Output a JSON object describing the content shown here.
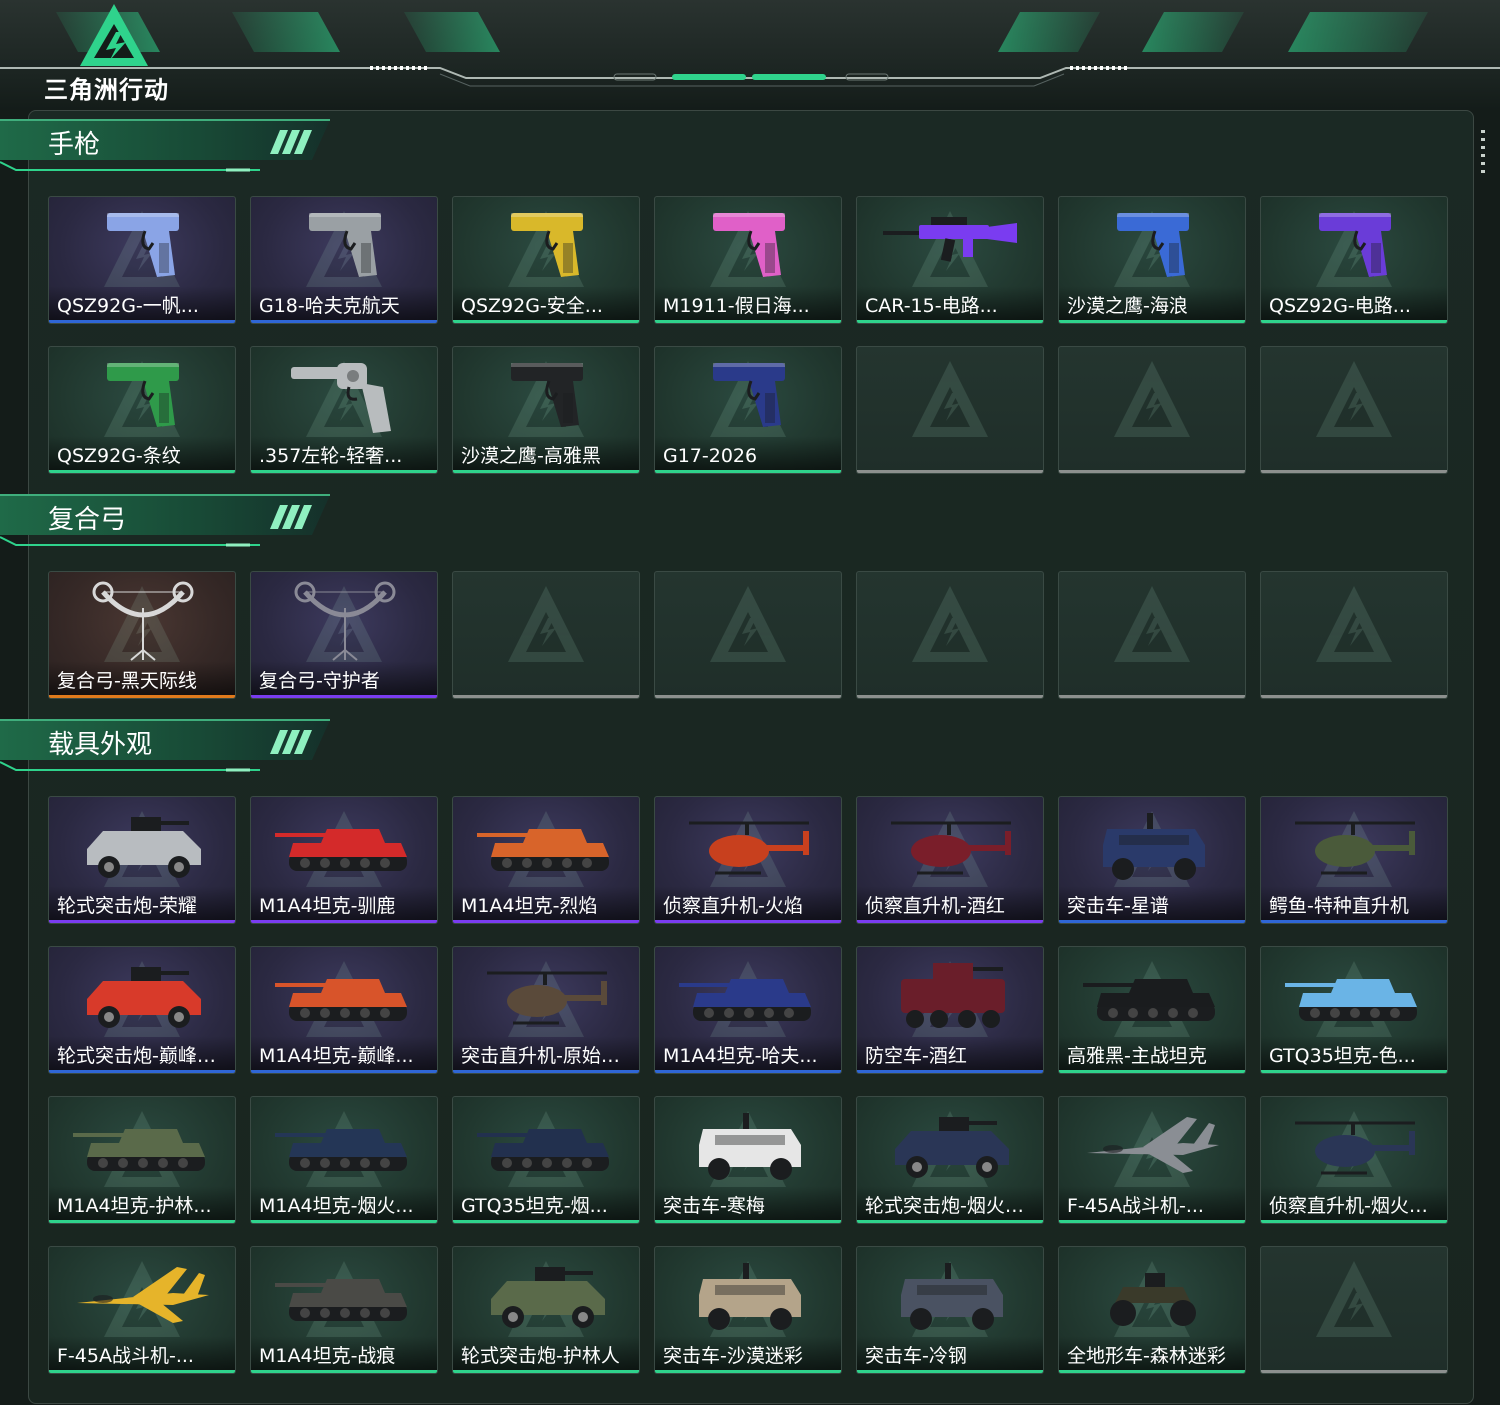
{
  "app": {
    "logo_text": "三角洲行动"
  },
  "colors": {
    "bg": "#141c19",
    "accent": "#2fd38c",
    "blue": "#2f66d6",
    "purple": "#7a3cf0",
    "orange": "#e07a1c",
    "gray": "#8c908e"
  },
  "sections": [
    {
      "title": "手枪",
      "items": [
        {
          "label": "QSZ92G-一帆...",
          "rarity": "blue",
          "bg": "purple",
          "icon": "pistol-icon",
          "art": "#8aa4e6"
        },
        {
          "label": "G18-哈夫克航天",
          "rarity": "blue",
          "bg": "purple",
          "icon": "pistol-icon",
          "art": "#9aa0a4"
        },
        {
          "label": "QSZ92G-安全...",
          "rarity": "green",
          "bg": "teal",
          "icon": "pistol-icon",
          "art": "#d9b82a"
        },
        {
          "label": "M1911-假日海...",
          "rarity": "green",
          "bg": "teal",
          "icon": "pistol-icon",
          "art": "#e060c8"
        },
        {
          "label": "CAR-15-电路...",
          "rarity": "green",
          "bg": "teal",
          "icon": "rifle-icon",
          "art": "#7a3cf0"
        },
        {
          "label": "沙漠之鹰-海浪",
          "rarity": "green",
          "bg": "teal",
          "icon": "pistol-icon",
          "art": "#3a6ad6"
        },
        {
          "label": "QSZ92G-电路...",
          "rarity": "green",
          "bg": "teal",
          "icon": "pistol-icon",
          "art": "#6a3cd8"
        },
        {
          "label": "QSZ92G-条纹",
          "rarity": "green",
          "bg": "teal",
          "icon": "pistol-icon",
          "art": "#2f9a4a"
        },
        {
          "label": ".357左轮-轻奢...",
          "rarity": "green",
          "bg": "teal",
          "icon": "revolver-icon",
          "art": "#b8bcbe"
        },
        {
          "label": "沙漠之鹰-高雅黑",
          "rarity": "green",
          "bg": "teal",
          "icon": "pistol-icon",
          "art": "#222426"
        },
        {
          "label": "G17-2026",
          "rarity": "green",
          "bg": "teal",
          "icon": "pistol-icon",
          "art": "#2a3a8a"
        },
        {
          "empty": true
        },
        {
          "empty": true
        },
        {
          "empty": true
        }
      ]
    },
    {
      "title": "复合弓",
      "items": [
        {
          "label": "复合弓-黑天际线",
          "rarity": "orange",
          "bg": "brown",
          "icon": "bow-icon",
          "art": "#d8d8d8"
        },
        {
          "label": "复合弓-守护者",
          "rarity": "purple",
          "bg": "purple",
          "icon": "bow-icon",
          "art": "#8a8a96"
        },
        {
          "empty": true
        },
        {
          "empty": true
        },
        {
          "empty": true
        },
        {
          "empty": true
        },
        {
          "empty": true
        }
      ]
    },
    {
      "title": "载具外观",
      "items": [
        {
          "label": "轮式突击炮-荣耀",
          "rarity": "purple",
          "bg": "purple",
          "icon": "armored-car-icon",
          "art": "#b8bcc0"
        },
        {
          "label": "M1A4坦克-驯鹿",
          "rarity": "purple",
          "bg": "purple",
          "icon": "tank-icon",
          "art": "#d42a2a"
        },
        {
          "label": "M1A4坦克-烈焰",
          "rarity": "purple",
          "bg": "purple",
          "icon": "tank-icon",
          "art": "#d8642a"
        },
        {
          "label": "侦察直升机-火焰",
          "rarity": "purple",
          "bg": "purple",
          "icon": "helicopter-icon",
          "art": "#c8401e"
        },
        {
          "label": "侦察直升机-酒红",
          "rarity": "purple",
          "bg": "purple",
          "icon": "helicopter-icon",
          "art": "#7a1e2a"
        },
        {
          "label": "突击车-星谱",
          "rarity": "blue",
          "bg": "purple",
          "icon": "assault-vehicle-icon",
          "art": "#2a3a6a"
        },
        {
          "label": "鳄鱼-特种直升机",
          "rarity": "blue",
          "bg": "purple",
          "icon": "helicopter-icon",
          "art": "#4a5a3a"
        },
        {
          "label": "轮式突击炮-巅峰竞...",
          "rarity": "blue",
          "bg": "purple",
          "icon": "armored-car-icon",
          "art": "#d83a2a"
        },
        {
          "label": "M1A4坦克-巅峰...",
          "rarity": "blue",
          "bg": "purple",
          "icon": "tank-icon",
          "art": "#d8542a"
        },
        {
          "label": "突击直升机-原始伪...",
          "rarity": "blue",
          "bg": "purple",
          "icon": "helicopter-icon",
          "art": "#5a4a3a"
        },
        {
          "label": "M1A4坦克-哈夫...",
          "rarity": "blue",
          "bg": "purple",
          "icon": "tank-icon",
          "art": "#2a3a8a"
        },
        {
          "label": "防空车-酒红",
          "rarity": "blue",
          "bg": "purple",
          "icon": "aa-vehicle-icon",
          "art": "#6a1e2a"
        },
        {
          "label": "高雅黑-主战坦克",
          "rarity": "green",
          "bg": "teal",
          "icon": "tank-icon",
          "art": "#1a1c1e"
        },
        {
          "label": "GTQ35坦克-色...",
          "rarity": "green",
          "bg": "teal",
          "icon": "tank-icon",
          "art": "#6ab4e6"
        },
        {
          "label": "M1A4坦克-护林...",
          "rarity": "green",
          "bg": "teal",
          "icon": "tank-icon",
          "art": "#5a6a4a"
        },
        {
          "label": "M1A4坦克-烟火...",
          "rarity": "green",
          "bg": "teal",
          "icon": "tank-icon",
          "art": "#243656"
        },
        {
          "label": "GTQ35坦克-烟...",
          "rarity": "green",
          "bg": "teal",
          "icon": "tank-icon",
          "art": "#22304e"
        },
        {
          "label": "突击车-寒梅",
          "rarity": "green",
          "bg": "teal",
          "icon": "assault-vehicle-icon",
          "art": "#e6e6e6"
        },
        {
          "label": "轮式突击炮-烟火2...",
          "rarity": "green",
          "bg": "teal",
          "icon": "armored-car-icon",
          "art": "#2a3656"
        },
        {
          "label": "F-45A战斗机-...",
          "rarity": "green",
          "bg": "teal",
          "icon": "jet-icon",
          "art": "#8a8e94"
        },
        {
          "label": "侦察直升机-烟火2...",
          "rarity": "green",
          "bg": "teal",
          "icon": "helicopter-icon",
          "art": "#2a3656"
        },
        {
          "label": "F-45A战斗机-...",
          "rarity": "green",
          "bg": "teal",
          "icon": "jet-icon",
          "art": "#e6b42a"
        },
        {
          "label": "M1A4坦克-战痕",
          "rarity": "green",
          "bg": "teal",
          "icon": "tank-icon",
          "art": "#4a4a46"
        },
        {
          "label": "轮式突击炮-护林人",
          "rarity": "green",
          "bg": "teal",
          "icon": "armored-car-icon",
          "art": "#5a6a4a"
        },
        {
          "label": "突击车-沙漠迷彩",
          "rarity": "green",
          "bg": "teal",
          "icon": "assault-vehicle-icon",
          "art": "#b4a48a"
        },
        {
          "label": "突击车-冷钢",
          "rarity": "green",
          "bg": "teal",
          "icon": "assault-vehicle-icon",
          "art": "#4a5262"
        },
        {
          "label": "全地形车-森林迷彩",
          "rarity": "green",
          "bg": "teal",
          "icon": "atv-icon",
          "art": "#3a3a2a"
        },
        {
          "empty": true
        }
      ]
    }
  ]
}
